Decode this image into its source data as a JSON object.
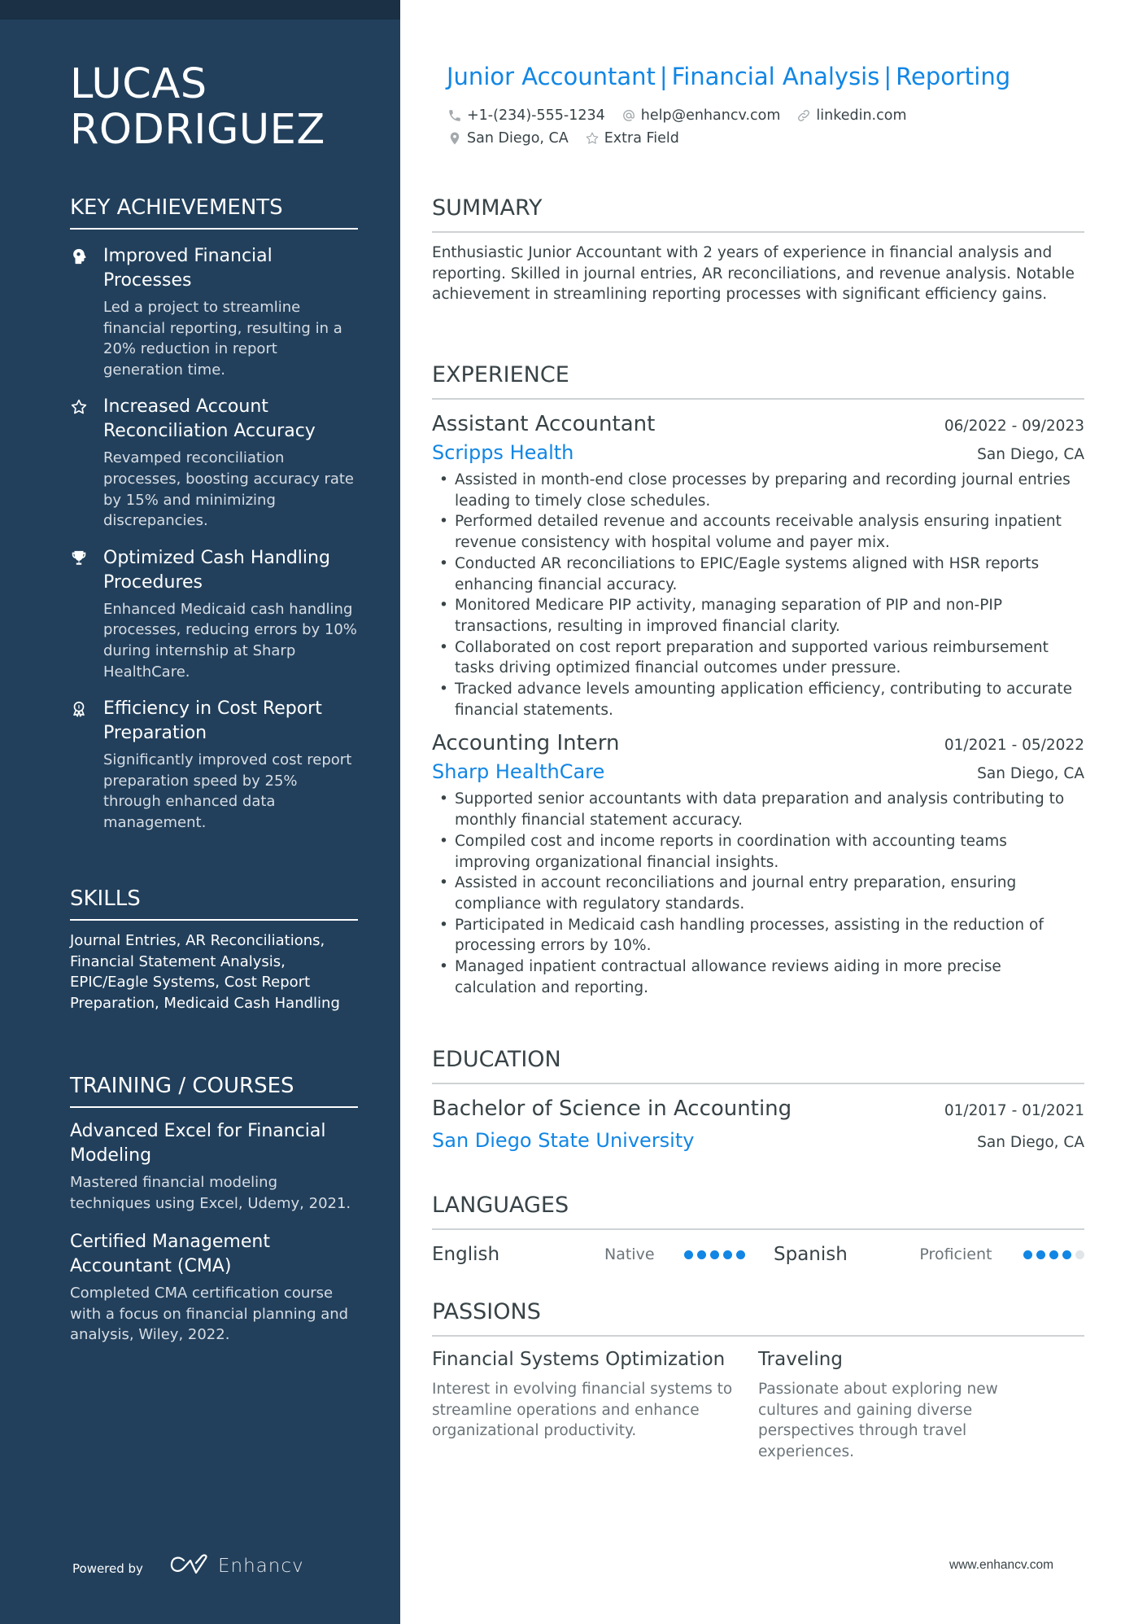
{
  "name": "LUCAS RODRIGUEZ",
  "headline": [
    "Junior Accountant",
    "Financial Analysis",
    "Reporting"
  ],
  "contacts": {
    "phone": "+1-(234)-555-1234",
    "email": "help@enhancv.com",
    "link": "linkedin.com",
    "location": "San Diego, CA",
    "extra": "Extra Field"
  },
  "colors": {
    "sidebar": "#22405c",
    "accent": "#1186e4",
    "text": "#384347"
  },
  "sidebar": {
    "achievements_heading": "KEY ACHIEVEMENTS",
    "achievements": [
      {
        "icon": "head-icon",
        "title": "Improved Financial Processes",
        "desc": "Led a project to streamline financial reporting, resulting in a 20% reduction in report generation time."
      },
      {
        "icon": "star-icon",
        "title": "Increased Account Reconciliation Accuracy",
        "desc": "Revamped reconciliation processes, boosting accuracy rate by 15% and minimizing discrepancies."
      },
      {
        "icon": "trophy-icon",
        "title": "Optimized Cash Handling Procedures",
        "desc": "Enhanced Medicaid cash handling processes, reducing errors by 10% during internship at Sharp HealthCare."
      },
      {
        "icon": "medal-icon",
        "title": "Efficiency in Cost Report Preparation",
        "desc": "Significantly improved cost report preparation speed by 25% through enhanced data management."
      }
    ],
    "skills_heading": "SKILLS",
    "skills": "Journal Entries, AR Reconciliations, Financial Statement Analysis, EPIC/Eagle Systems, Cost Report Preparation, Medicaid Cash Handling",
    "training_heading": "TRAINING / COURSES",
    "courses": [
      {
        "title": "Advanced Excel for Financial Modeling",
        "desc": "Mastered financial modeling techniques using Excel, Udemy, 2021."
      },
      {
        "title": "Certified Management Accountant (CMA)",
        "desc": "Completed CMA certification course with a focus on financial planning and analysis, Wiley, 2022."
      }
    ],
    "powered_by": "Powered by",
    "brand": "Enhancv"
  },
  "summary": {
    "heading": "SUMMARY",
    "text": "Enthusiastic Junior Accountant with 2 years of experience in financial analysis and reporting. Skilled in journal entries, AR reconciliations, and revenue analysis. Notable achievement in streamlining reporting processes with significant efficiency gains."
  },
  "experience": {
    "heading": "EXPERIENCE",
    "jobs": [
      {
        "title": "Assistant Accountant",
        "dates": "06/2022 - 09/2023",
        "company": "Scripps Health",
        "location": "San Diego, CA",
        "bullets": [
          "Assisted in month-end close processes by preparing and recording journal entries leading to timely close schedules.",
          "Performed detailed revenue and accounts receivable analysis ensuring inpatient revenue consistency with hospital volume and payer mix.",
          "Conducted AR reconciliations to EPIC/Eagle systems aligned with HSR reports enhancing financial accuracy.",
          "Monitored Medicare PIP activity, managing separation of PIP and non-PIP transactions, resulting in improved financial clarity.",
          "Collaborated on cost report preparation and supported various reimbursement tasks driving optimized financial outcomes under pressure.",
          "Tracked advance levels amounting application efficiency, contributing to accurate financial statements."
        ]
      },
      {
        "title": "Accounting Intern",
        "dates": "01/2021 - 05/2022",
        "company": "Sharp HealthCare",
        "location": "San Diego, CA",
        "bullets": [
          "Supported senior accountants with data preparation and analysis contributing to monthly financial statement accuracy.",
          "Compiled cost and income reports in coordination with accounting teams improving organizational financial insights.",
          "Assisted in account reconciliations and journal entry preparation, ensuring compliance with regulatory standards.",
          "Participated in Medicaid cash handling processes, assisting in the reduction of processing errors by 10%.",
          "Managed inpatient contractual allowance reviews aiding in more precise calculation and reporting."
        ]
      }
    ]
  },
  "education": {
    "heading": "EDUCATION",
    "degree": "Bachelor of Science in Accounting",
    "dates": "01/2017 - 01/2021",
    "school": "San Diego State University",
    "location": "San Diego, CA"
  },
  "languages": {
    "heading": "LANGUAGES",
    "items": [
      {
        "name": "English",
        "level": "Native",
        "rating": 5,
        "max": 5
      },
      {
        "name": "Spanish",
        "level": "Proficient",
        "rating": 4,
        "max": 5
      }
    ]
  },
  "passions": {
    "heading": "PASSIONS",
    "items": [
      {
        "title": "Financial Systems Optimization",
        "desc": "Interest in evolving financial systems to streamline operations and enhance organizational productivity."
      },
      {
        "title": "Traveling",
        "desc": "Passionate about exploring new cultures and gaining diverse perspectives through travel experiences."
      }
    ]
  },
  "footer_url": "www.enhancv.com"
}
